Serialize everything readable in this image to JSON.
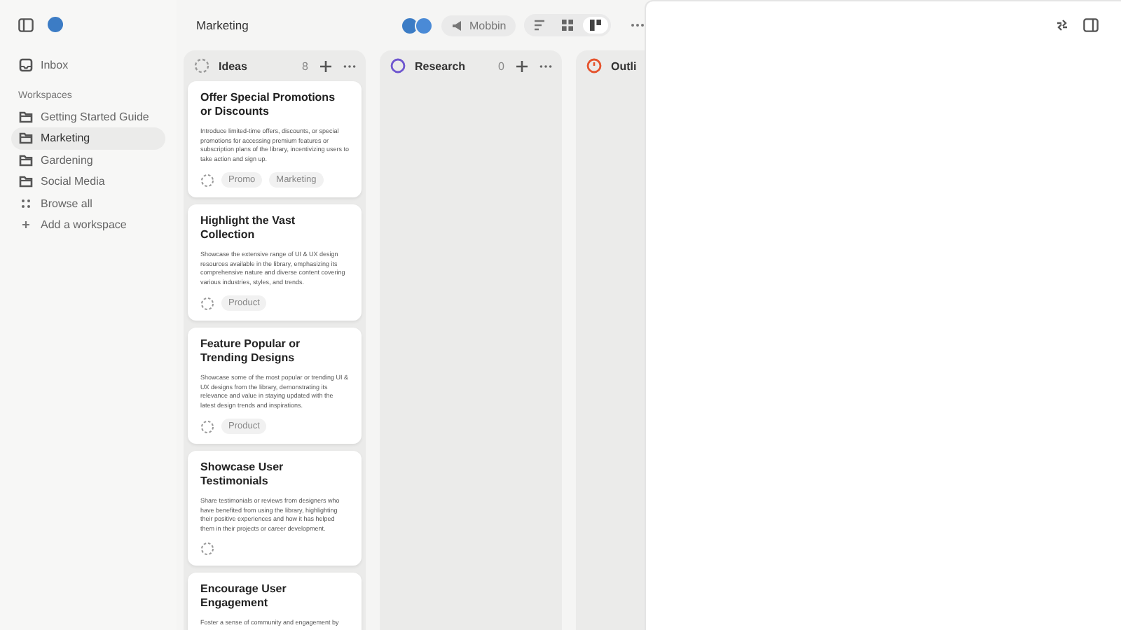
{
  "sidebar": {
    "items": [
      {
        "label": "Inbox",
        "kind": "inbox",
        "selected": false
      }
    ],
    "section_title": "Workspaces",
    "workspaces": [
      {
        "label": "Getting Started Guide",
        "kind": "folder",
        "selected": false
      },
      {
        "label": "Marketing",
        "kind": "folder",
        "selected": true
      },
      {
        "label": "Gardening",
        "kind": "folder",
        "selected": false
      },
      {
        "label": "Social Media",
        "kind": "folder",
        "selected": false
      },
      {
        "label": "Browse all",
        "kind": "grid",
        "selected": false
      },
      {
        "label": "Add a workspace",
        "kind": "add",
        "selected": false
      }
    ]
  },
  "header": {
    "title": "Marketing",
    "team": "Mobbin",
    "views": [
      {
        "kind": "list",
        "selected": false
      },
      {
        "kind": "grid",
        "selected": false
      },
      {
        "kind": "board",
        "selected": true
      }
    ]
  },
  "columns": [
    {
      "name": "Ideas",
      "kind": "backlog",
      "count": "8",
      "cards": [
        {
          "title": "Offer Special Promotions or Discounts",
          "text": "Introduce limited-time offers, discounts, or special promotions for accessing premium features or subscription plans of the library, incentivizing users to take action and sign up.",
          "tags": [
            "Promo",
            "Marketing"
          ]
        },
        {
          "title": "Highlight the Vast Collection",
          "text": "Showcase the extensive range of UI & UX design resources available in the library, emphasizing its comprehensive nature and diverse content covering various industries, styles, and trends.",
          "tags": [
            "Product"
          ]
        },
        {
          "title": "Feature Popular or Trending Designs",
          "text": "Showcase some of the most popular or trending UI & UX designs from the library, demonstrating its relevance and value in staying updated with the latest design trends and inspirations.",
          "tags": [
            "Product"
          ]
        },
        {
          "title": "Showcase User Testimonials",
          "text": "Share testimonials or reviews from designers who have benefited from using the library, highlighting their positive experiences and how it has helped them in their projects or career development."
        },
        {
          "title": "Encourage User Engagement",
          "text": "Foster a sense of community and engagement by"
        }
      ]
    },
    {
      "name": "Research",
      "kind": "todo",
      "count": "0"
    },
    {
      "name": "Outli",
      "kind": "progress"
    }
  ]
}
